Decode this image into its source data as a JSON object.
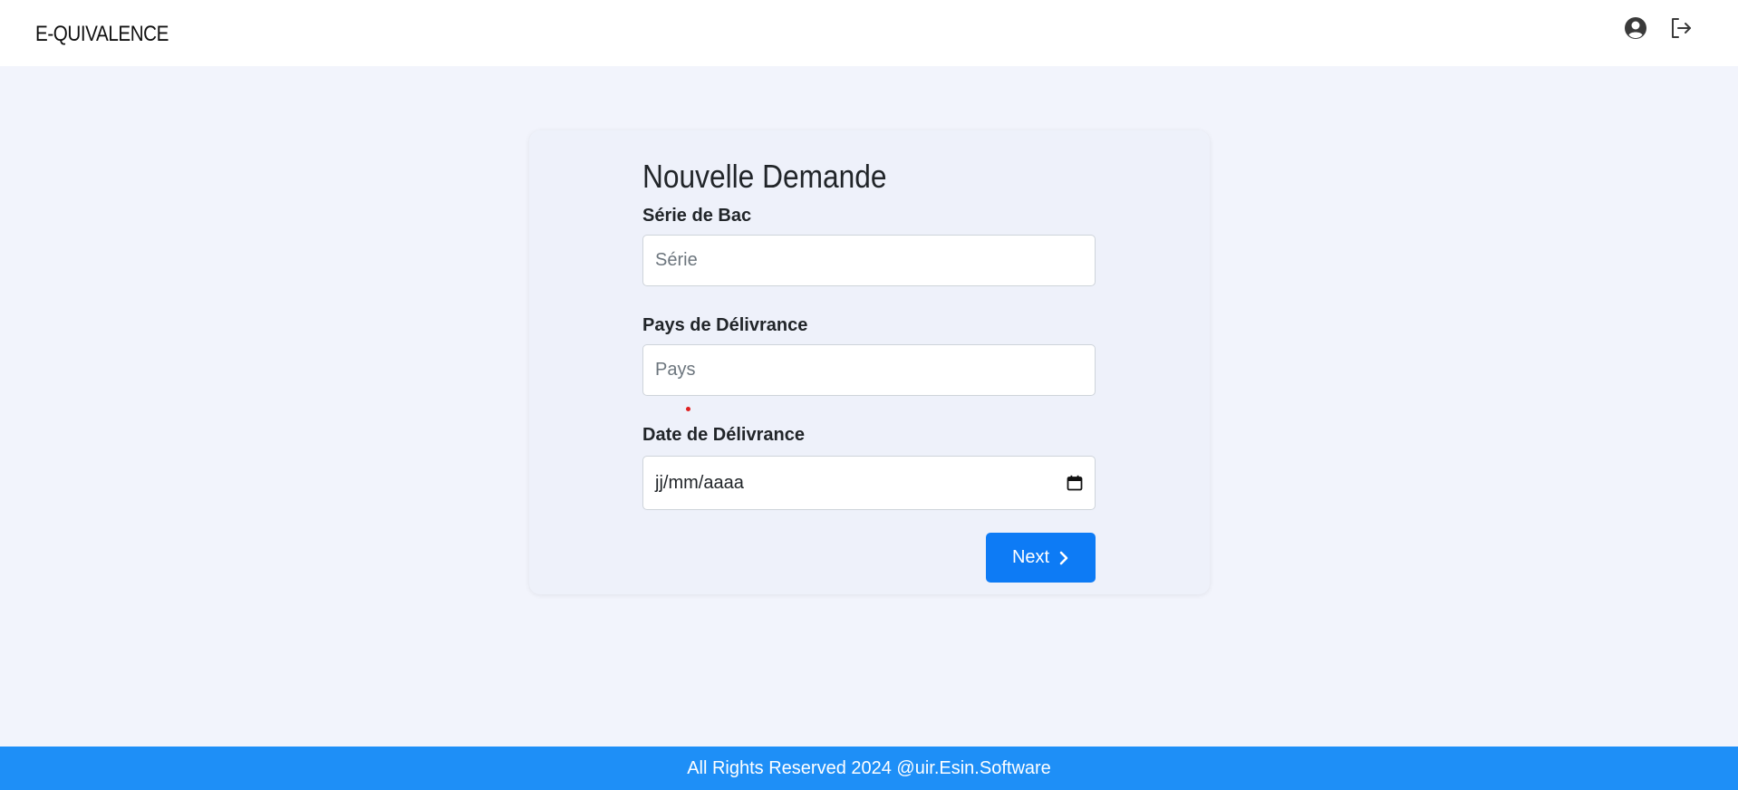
{
  "header": {
    "brand": "E-QUIVALENCE",
    "icons": [
      "user-circle-icon",
      "logout-icon"
    ]
  },
  "form": {
    "title": "Nouvelle Demande",
    "serie": {
      "label": "Série de Bac",
      "placeholder": "Série",
      "value": ""
    },
    "pays": {
      "label": "Pays de Délivrance",
      "placeholder": "Pays",
      "value": ""
    },
    "date": {
      "label": "Date de Délivrance",
      "placeholder": "jj/mm/aaaa",
      "icon": "calendar-icon"
    },
    "next_label": "Next"
  },
  "footer": {
    "text": "All Rights Reserved 2024 @uir.Esin.Software"
  },
  "colors": {
    "primary": "#0d7bf5",
    "footer": "#1e8ff7",
    "background": "#f2f4fc",
    "card": "#eef1fa"
  }
}
